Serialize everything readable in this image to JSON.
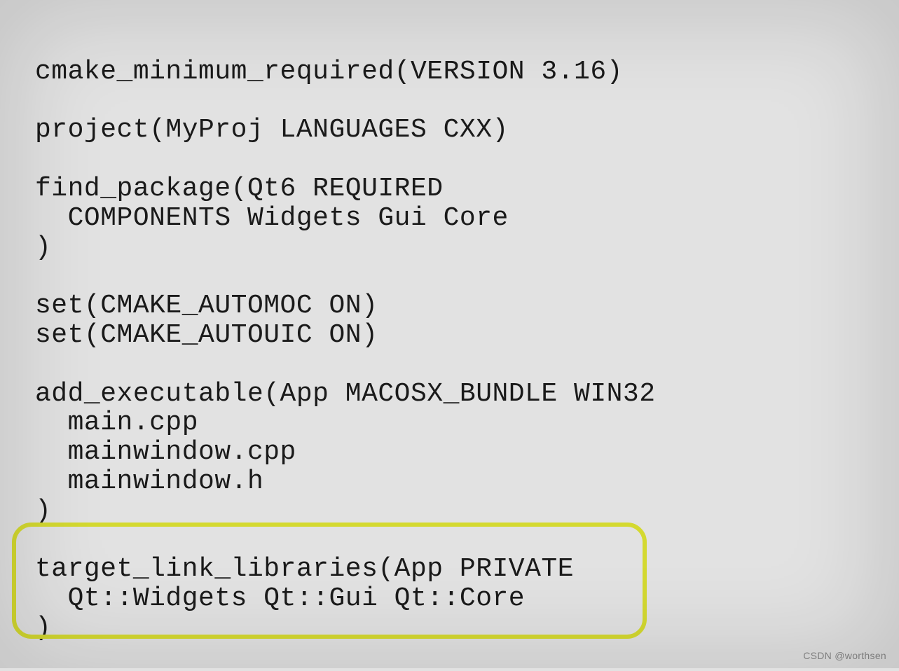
{
  "code": {
    "line1": "cmake_minimum_required(VERSION 3.16)",
    "line2": "",
    "line3": "project(MyProj LANGUAGES CXX)",
    "line4": "",
    "line5": "find_package(Qt6 REQUIRED",
    "line6": "  COMPONENTS Widgets Gui Core",
    "line7": ")",
    "line8": "",
    "line9": "set(CMAKE_AUTOMOC ON)",
    "line10": "set(CMAKE_AUTOUIC ON)",
    "line11": "",
    "line12": "add_executable(App MACOSX_BUNDLE WIN32",
    "line13": "  main.cpp",
    "line14": "  mainwindow.cpp",
    "line15": "  mainwindow.h",
    "line16": ")",
    "line17": "",
    "line18": "target_link_libraries(App PRIVATE",
    "line19": "  Qt::Widgets Qt::Gui Qt::Core",
    "line20": ")"
  },
  "watermark": "CSDN @worthsen"
}
